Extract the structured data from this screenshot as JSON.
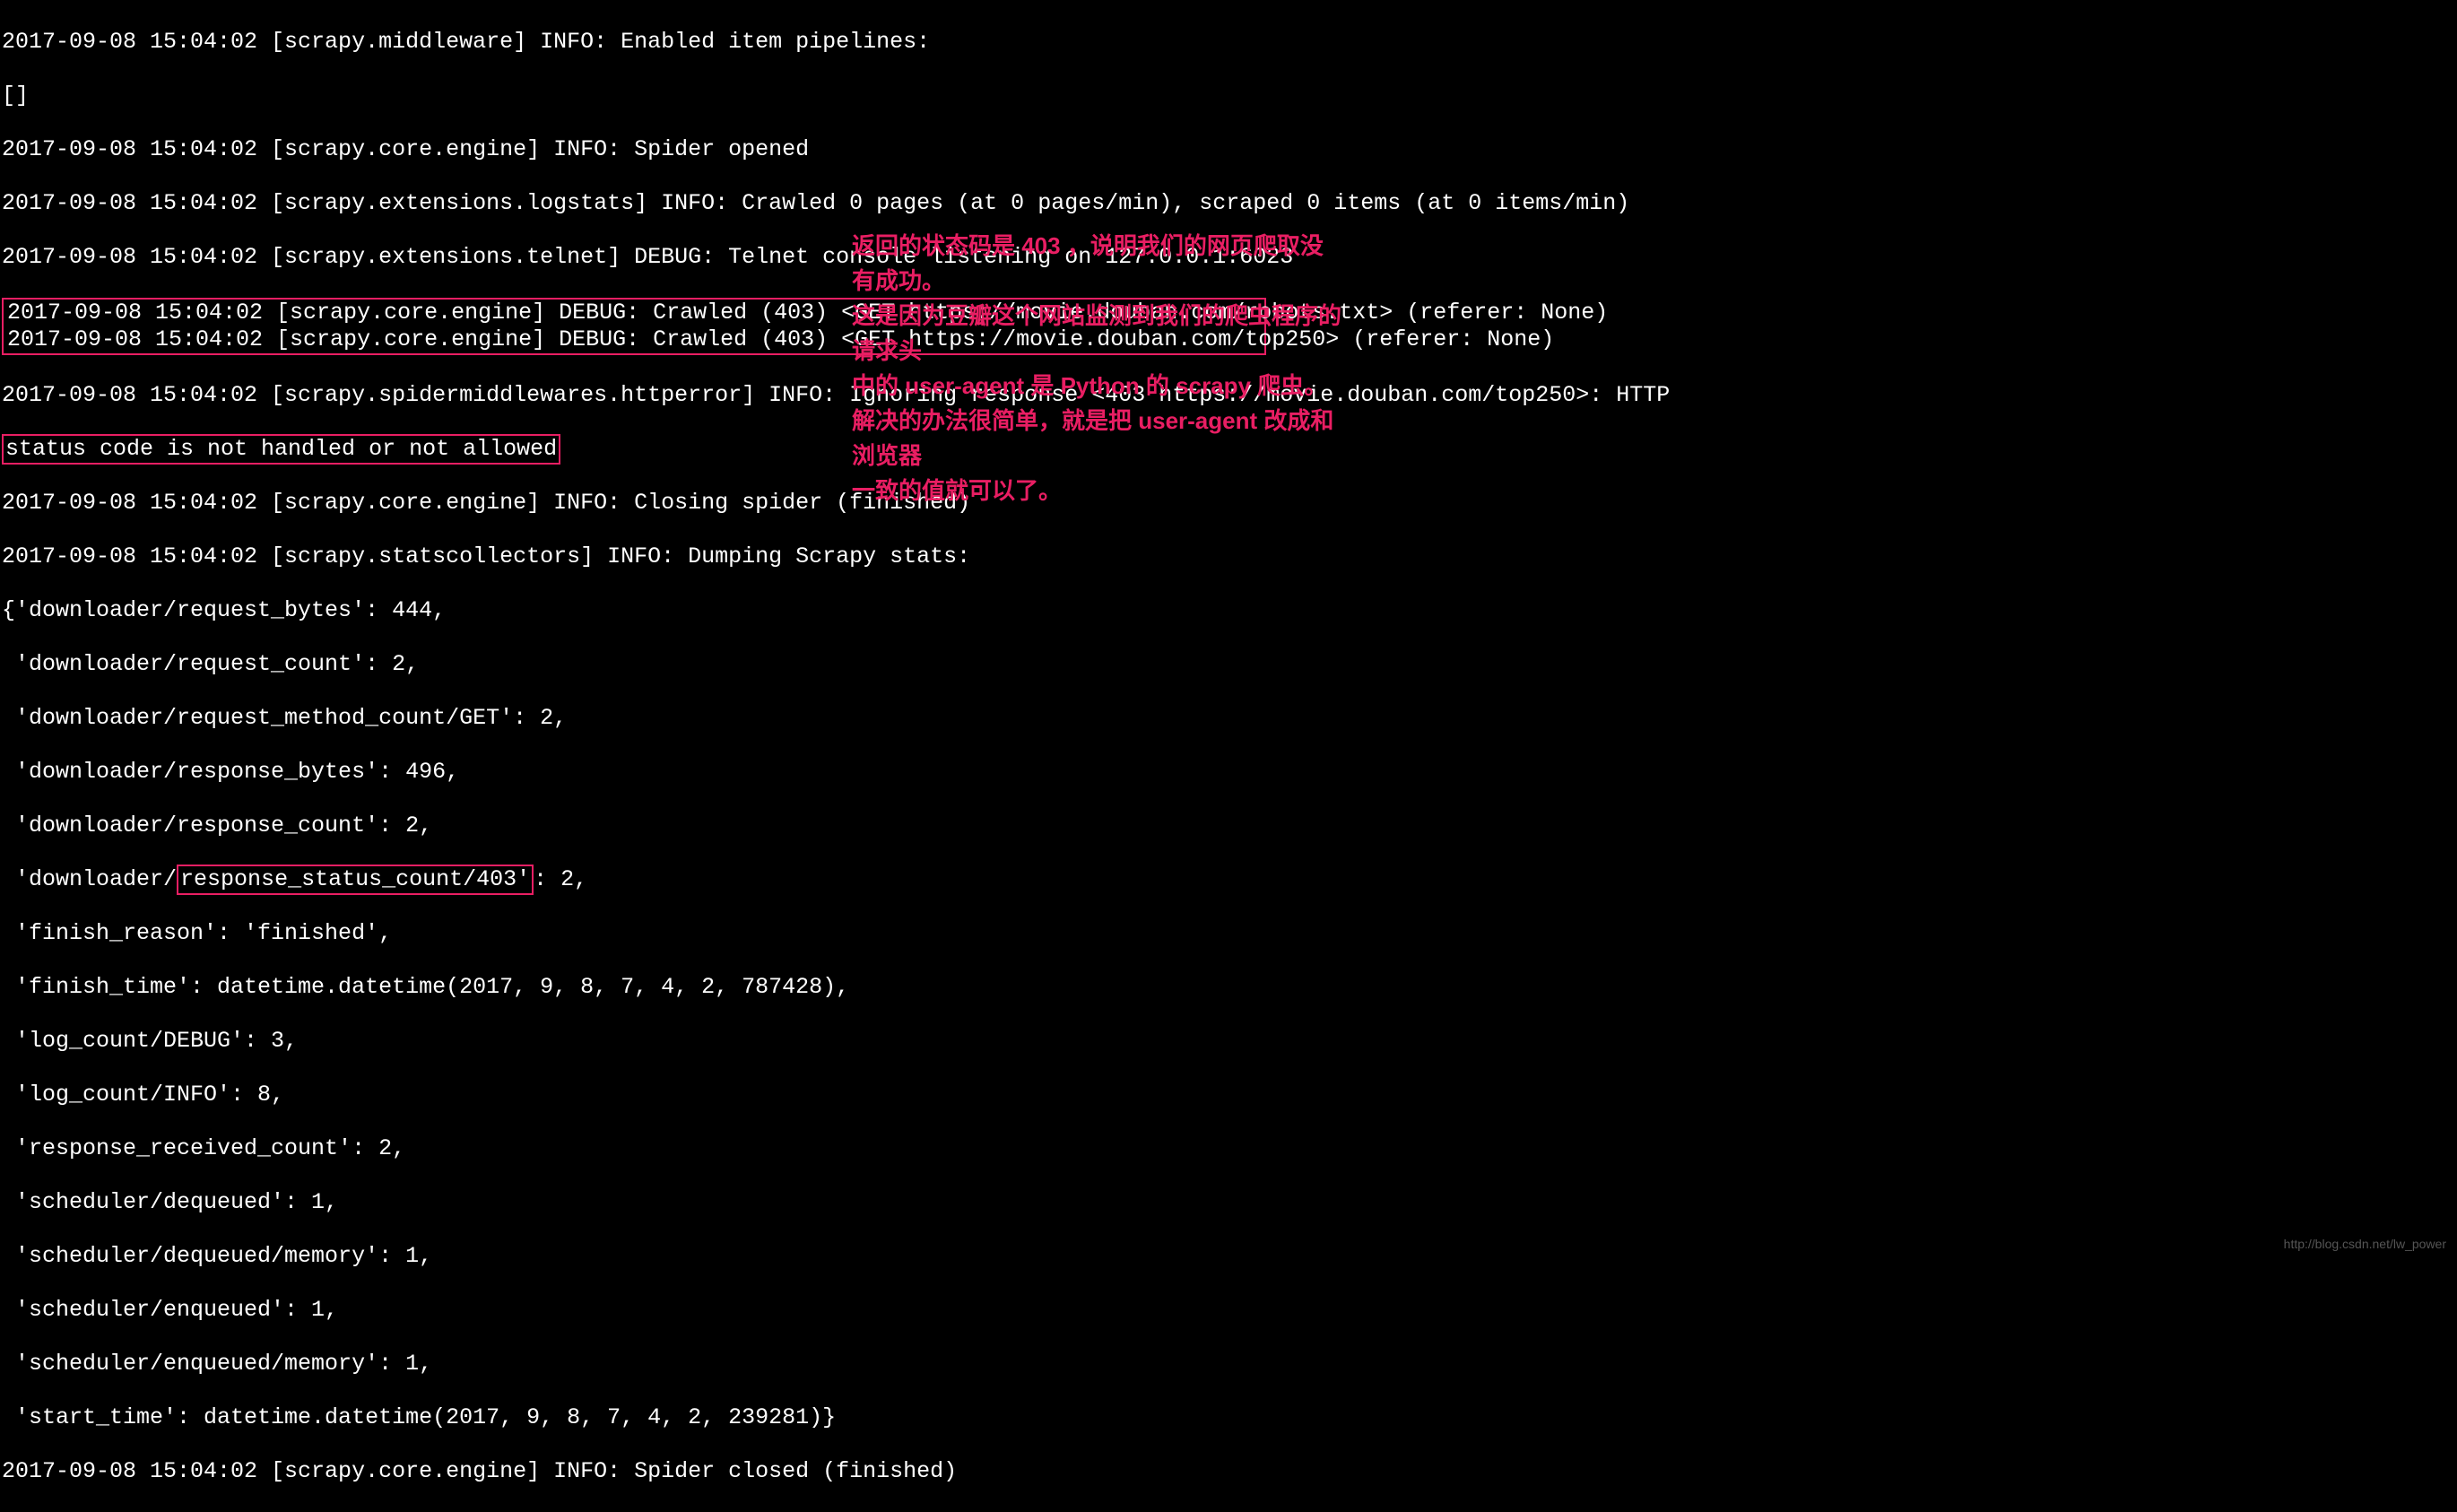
{
  "lines": {
    "l1": "2017-09-08 15:04:02 [scrapy.middleware] INFO: Enabled item pipelines:",
    "l2": "[]",
    "l3": "2017-09-08 15:04:02 [scrapy.core.engine] INFO: Spider opened",
    "l4": "2017-09-08 15:04:02 [scrapy.extensions.logstats] INFO: Crawled 0 pages (at 0 pages/min), scraped 0 items (at 0 items/min)",
    "l5": "2017-09-08 15:04:02 [scrapy.extensions.telnet] DEBUG: Telnet console listening on 127.0.0.1:6023",
    "l6": "2017-09-08 15:04:02 [scrapy.core.engine] DEBUG: Crawled (403) <GET https://movie.douban.com/robots.txt> (referer: None)",
    "l7": "2017-09-08 15:04:02 [scrapy.core.engine] DEBUG: Crawled (403) <GET https://movie.douban.com/top250> (referer: None)",
    "l8a": "2017-09-08 15:04:02 [scrapy.spidermiddlewares.httperror] INFO: Ignoring response <403 https://movie.douban.com/top250>: HTTP",
    "l8b": "status code is not handled or not allowed",
    "l9": "2017-09-08 15:04:02 [scrapy.core.engine] INFO: Closing spider (finished)",
    "l10": "2017-09-08 15:04:02 [scrapy.statscollectors] INFO: Dumping Scrapy stats:",
    "l11": "{'downloader/request_bytes': 444,",
    "l12": " 'downloader/request_count': 2,",
    "l13": " 'downloader/request_method_count/GET': 2,",
    "l14": " 'downloader/response_bytes': 496,",
    "l15": " 'downloader/response_count': 2,",
    "l16a": " 'downloader/",
    "l16b": "response_status_count/403'",
    "l16c": ": 2,",
    "l17": " 'finish_reason': 'finished',",
    "l18": " 'finish_time': datetime.datetime(2017, 9, 8, 7, 4, 2, 787428),",
    "l19": " 'log_count/DEBUG': 3,",
    "l20": " 'log_count/INFO': 8,",
    "l21": " 'response_received_count': 2,",
    "l22": " 'scheduler/dequeued': 1,",
    "l23": " 'scheduler/dequeued/memory': 1,",
    "l24": " 'scheduler/enqueued': 1,",
    "l25": " 'scheduler/enqueued/memory': 1,",
    "l26": " 'start_time': datetime.datetime(2017, 9, 8, 7, 4, 2, 239281)}",
    "l27": "2017-09-08 15:04:02 [scrapy.core.engine] INFO: Spider closed (finished)"
  },
  "annotation": {
    "line1": "返回的状态码是 403 ，说明我们的网页爬取没有成功。",
    "line2": "这是因为豆瓣这个网站监测到我们的爬虫程序的请求头",
    "line3": "中的 user-agent 是 Python 的 scrapy 爬虫。",
    "line4": "解决的办法很简单，就是把 user-agent 改成和浏览器",
    "line5": "一致的值就可以了。"
  },
  "watermark": "http://blog.csdn.net/lw_power"
}
